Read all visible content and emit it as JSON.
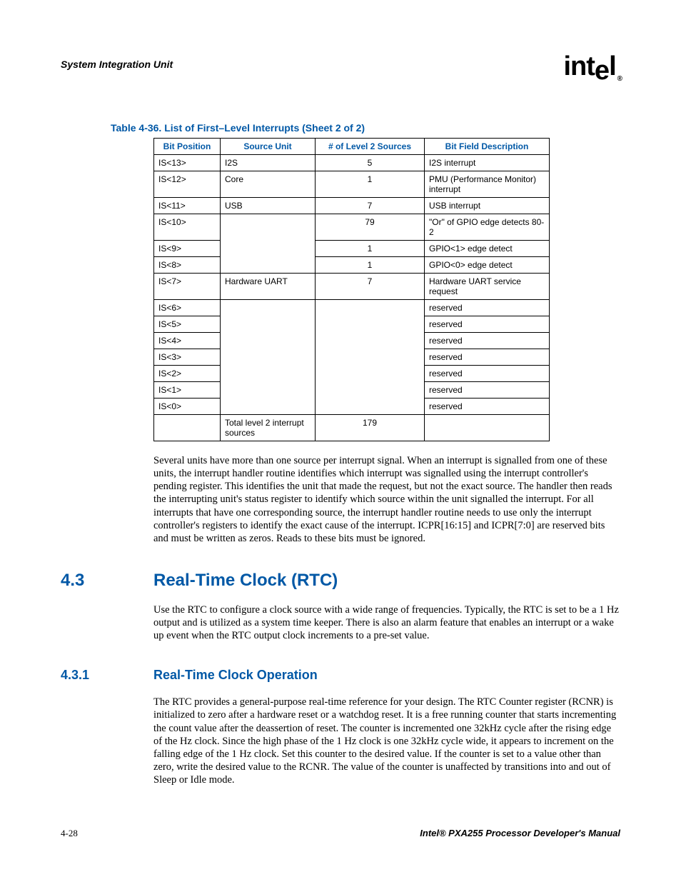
{
  "header": {
    "section_title": "System Integration Unit",
    "logo_text": "intel",
    "logo_reg": "®"
  },
  "table": {
    "caption": "Table 4-36. List of First–Level Interrupts (Sheet 2 of 2)",
    "headers": {
      "bit": "Bit Position",
      "src": "Source Unit",
      "cnt": "# of Level 2 Sources",
      "desc": "Bit Field Description"
    },
    "rows": [
      {
        "bit": "IS<13>",
        "src": "I2S",
        "cnt": "5",
        "desc": "I2S interrupt"
      },
      {
        "bit": "IS<12>",
        "src": "Core",
        "cnt": "1",
        "desc": "PMU (Performance Monitor) interrupt"
      },
      {
        "bit": "IS<11>",
        "src": "USB",
        "cnt": "7",
        "desc": "USB interrupt"
      },
      {
        "bit": "IS<10>",
        "src": "",
        "cnt": "79",
        "desc": "\"Or\" of GPIO edge detects 80-2"
      },
      {
        "bit": "IS<9>",
        "src": "",
        "cnt": "1",
        "desc": "GPIO<1> edge detect"
      },
      {
        "bit": "IS<8>",
        "src": "",
        "cnt": "1",
        "desc": "GPIO<0> edge detect"
      },
      {
        "bit": "IS<7>",
        "src": "Hardware UART",
        "cnt": "7",
        "desc": "Hardware UART service request"
      },
      {
        "bit": "IS<6>",
        "src": "",
        "cnt": "",
        "desc": "reserved"
      },
      {
        "bit": "IS<5>",
        "src": "",
        "cnt": "",
        "desc": "reserved"
      },
      {
        "bit": "IS<4>",
        "src": "",
        "cnt": "",
        "desc": "reserved"
      },
      {
        "bit": "IS<3>",
        "src": "",
        "cnt": "",
        "desc": "reserved"
      },
      {
        "bit": "IS<2>",
        "src": "",
        "cnt": "",
        "desc": "reserved"
      },
      {
        "bit": "IS<1>",
        "src": "",
        "cnt": "",
        "desc": "reserved"
      },
      {
        "bit": "IS<0>",
        "src": "",
        "cnt": "",
        "desc": "reserved"
      }
    ],
    "total_row": {
      "src": "Total level 2 interrupt sources",
      "cnt": "179"
    }
  },
  "paragraphs": {
    "p1": "Several units have more than one source per interrupt signal. When an interrupt is signalled from one of these units, the interrupt handler routine identifies which interrupt was signalled using the interrupt controller's pending register. This identifies the unit that made the request, but not the exact source. The handler then reads the interrupting unit's status register to identify which source within the unit signalled the interrupt. For all interrupts that have one corresponding source, the interrupt handler routine needs to use only the interrupt controller's registers to identify the exact cause of the interrupt. ICPR[16:15] and ICPR[7:0] are reserved bits and must be written as zeros. Reads to these bits must be ignored.",
    "p2": "Use the RTC to configure a clock source with a wide range of frequencies. Typically, the RTC is set to be a 1 Hz output and is utilized as a system time keeper. There is also an alarm feature that enables an interrupt or a wake up event when the RTC output clock increments to a pre-set value.",
    "p3": "The RTC provides a general-purpose real-time reference for your design. The RTC Counter register (RCNR) is initialized to zero after a hardware reset or a watchdog reset. It is a free running counter that starts incrementing the count value after the deassertion of reset. The counter is incremented one 32kHz cycle after the rising edge of the Hz clock. Since the high phase of the 1 Hz clock is one 32kHz cycle wide, it appears to increment on the falling edge of the 1 Hz clock. Set this counter to the desired value. If the counter is set to a value other than zero, write the desired value to the RCNR. The value of the counter is unaffected by transitions into and out of Sleep or Idle mode."
  },
  "sections": {
    "s1_num": "4.3",
    "s1_title": "Real-Time Clock (RTC)",
    "s2_num": "4.3.1",
    "s2_title": "Real-Time Clock Operation"
  },
  "footer": {
    "page": "4-28",
    "doc": "Intel® PXA255 Processor Developer's Manual"
  }
}
